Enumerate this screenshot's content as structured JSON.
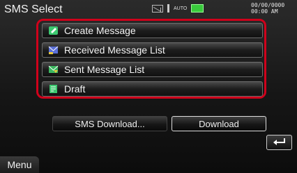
{
  "header": {
    "title": "SMS Select",
    "status_auto": "AUTO",
    "clock": "00/00/0000\n00:00 AM",
    "icons": [
      "sms-envelope-icon",
      "antenna-icon",
      "battery-icon"
    ]
  },
  "list": {
    "items": [
      {
        "label": "Create Message",
        "icon": "create-message-icon"
      },
      {
        "label": "Received Message List",
        "icon": "received-messages-icon"
      },
      {
        "label": "Sent Message List",
        "icon": "sent-messages-icon"
      },
      {
        "label": "Draft",
        "icon": "draft-icon"
      }
    ]
  },
  "footer": {
    "sms_download_label": "SMS Download...",
    "download_button": "Download",
    "back_icon": "back-arrow-icon",
    "menu_label": "Menu"
  },
  "colors": {
    "highlight_border": "#d0011b",
    "battery": "#39c93c"
  }
}
